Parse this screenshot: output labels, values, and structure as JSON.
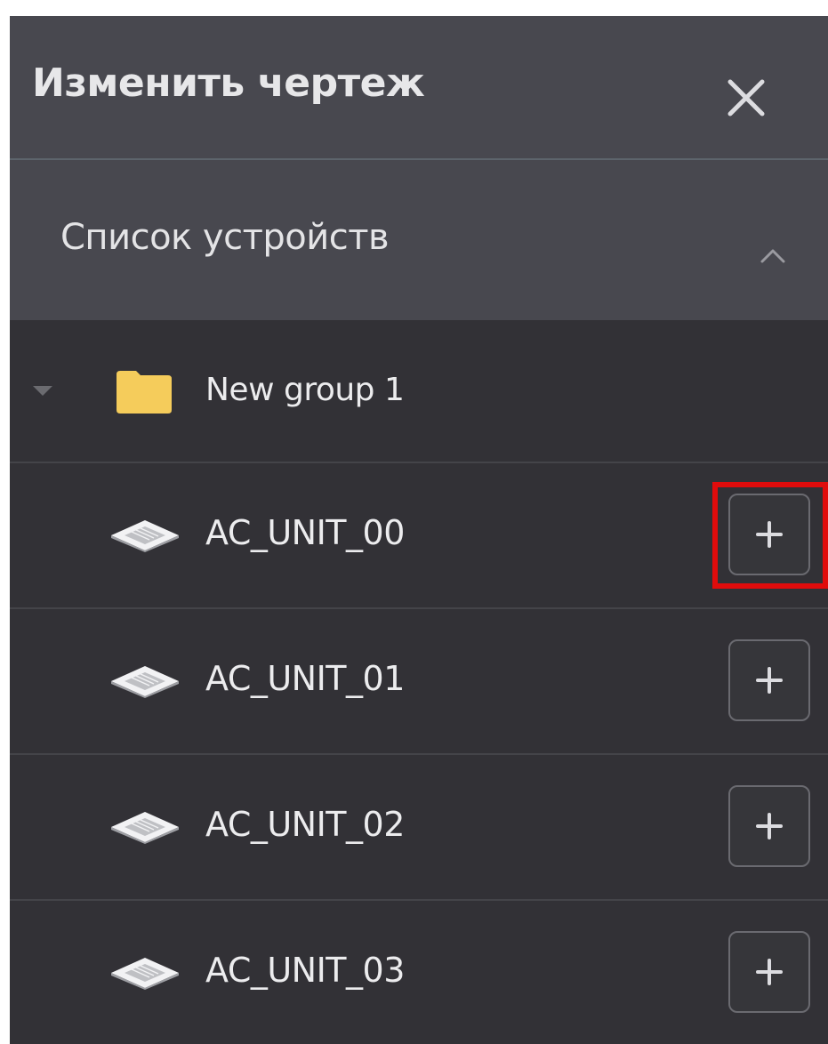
{
  "panel": {
    "title": "Изменить чертеж",
    "close_icon": "close-icon"
  },
  "section": {
    "title": "Список устройств",
    "collapse_icon": "chevron-up-icon"
  },
  "group": {
    "label": "New group 1",
    "expand_icon": "caret-down-icon",
    "folder_icon": "folder-icon",
    "folder_color": "#f5cc5b"
  },
  "devices": [
    {
      "label": "AC_UNIT_00",
      "icon": "ceiling-cassette-icon",
      "add_icon": "plus-icon",
      "highlighted": true
    },
    {
      "label": "AC_UNIT_01",
      "icon": "ceiling-cassette-icon",
      "add_icon": "plus-icon",
      "highlighted": false
    },
    {
      "label": "AC_UNIT_02",
      "icon": "ceiling-cassette-icon",
      "add_icon": "plus-icon",
      "highlighted": false
    },
    {
      "label": "AC_UNIT_03",
      "icon": "ceiling-cassette-icon",
      "add_icon": "plus-icon",
      "highlighted": false
    }
  ],
  "colors": {
    "header_bg": "#48484f",
    "list_bg": "#323136",
    "highlight": "#e00c0c",
    "text": "#ececee"
  }
}
